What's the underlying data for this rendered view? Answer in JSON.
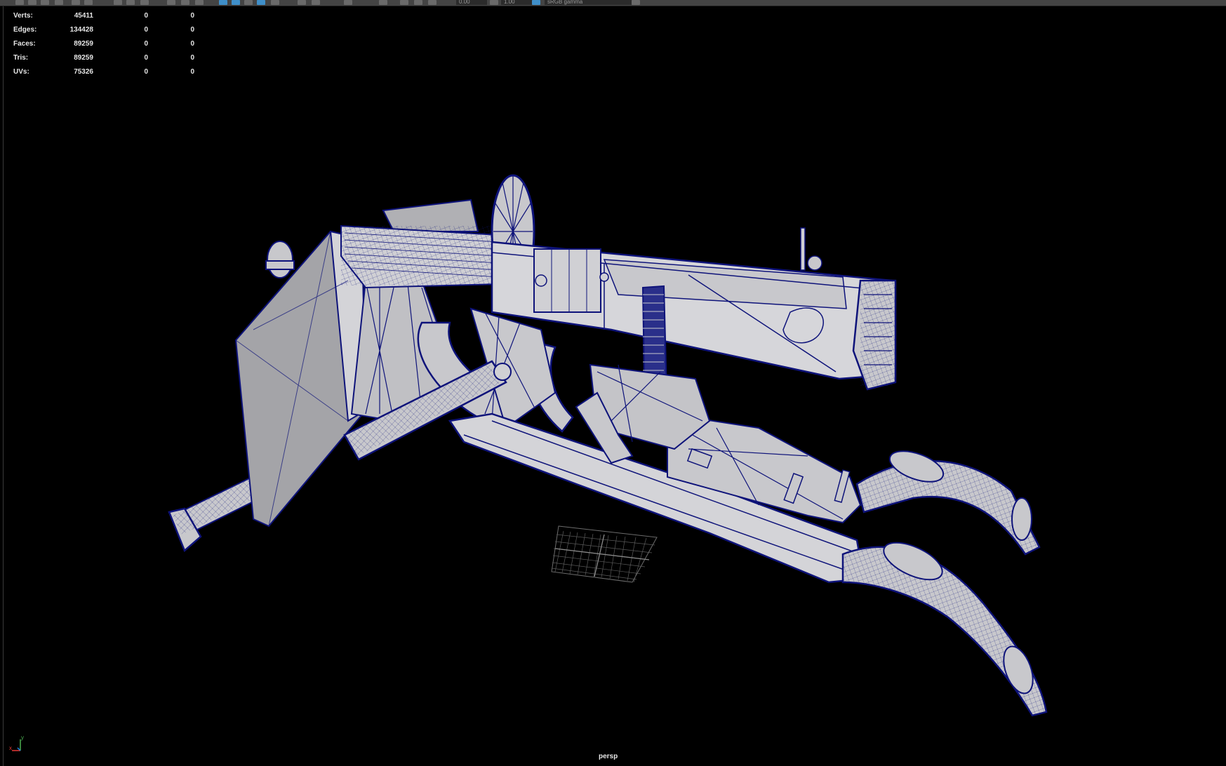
{
  "toolbar": {
    "field_1": "0.00",
    "field_2": "1.00",
    "colorspace": "sRGB gamma"
  },
  "hud": [
    {
      "label": "Verts:",
      "v1": "45411",
      "v2": "0",
      "v3": "0"
    },
    {
      "label": "Edges:",
      "v1": "134428",
      "v2": "0",
      "v3": "0"
    },
    {
      "label": "Faces:",
      "v1": "89259",
      "v2": "0",
      "v3": "0"
    },
    {
      "label": "Tris:",
      "v1": "89259",
      "v2": "0",
      "v3": "0"
    },
    {
      "label": "UVs:",
      "v1": "75326",
      "v2": "0",
      "v3": "0"
    }
  ],
  "camera": "persp",
  "axis": {
    "x": "x",
    "y": "y"
  },
  "colors": {
    "wire": "#0e137a",
    "surface": "#c8c8cc",
    "shadow": "#9d9da2",
    "bg": "#000000"
  }
}
